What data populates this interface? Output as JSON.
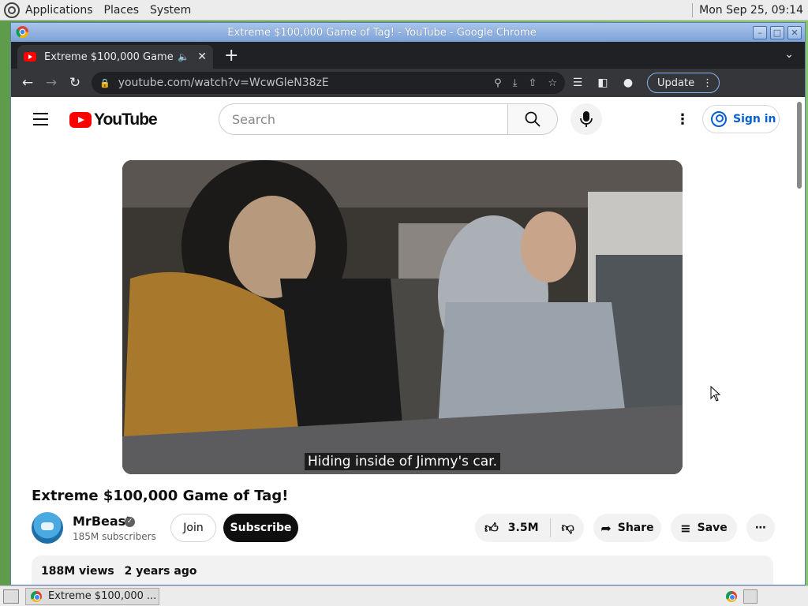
{
  "desktop": {
    "menus": [
      "Applications",
      "Places",
      "System"
    ],
    "clock": "Mon Sep 25, 09:14"
  },
  "window": {
    "title": "Extreme $100,000 Game of Tag! - YouTube - Google Chrome"
  },
  "browser": {
    "tab_title": "Extreme $100,000 Game of Tag! - YouTube",
    "url": "youtube.com/watch?v=WcwGleN38zE",
    "update_label": "Update"
  },
  "youtube": {
    "logo_text": "YouTube",
    "search_placeholder": "Search",
    "sign_in": "Sign in",
    "caption": "Hiding inside of Jimmy's car.",
    "video_title": "Extreme $100,000 Game of Tag!",
    "channel_name": "MrBeast",
    "subscribers": "185M subscribers",
    "join_label": "Join",
    "subscribe_label": "Subscribe",
    "likes": "3.5M",
    "share_label": "Share",
    "save_label": "Save",
    "views": "188M views",
    "age": "2 years ago"
  },
  "taskbar": {
    "task_label": "Extreme $100,000 ..."
  },
  "colors": {
    "brand_red": "#ff0000",
    "link_blue": "#065fd4",
    "chrome_dark": "#202124"
  }
}
